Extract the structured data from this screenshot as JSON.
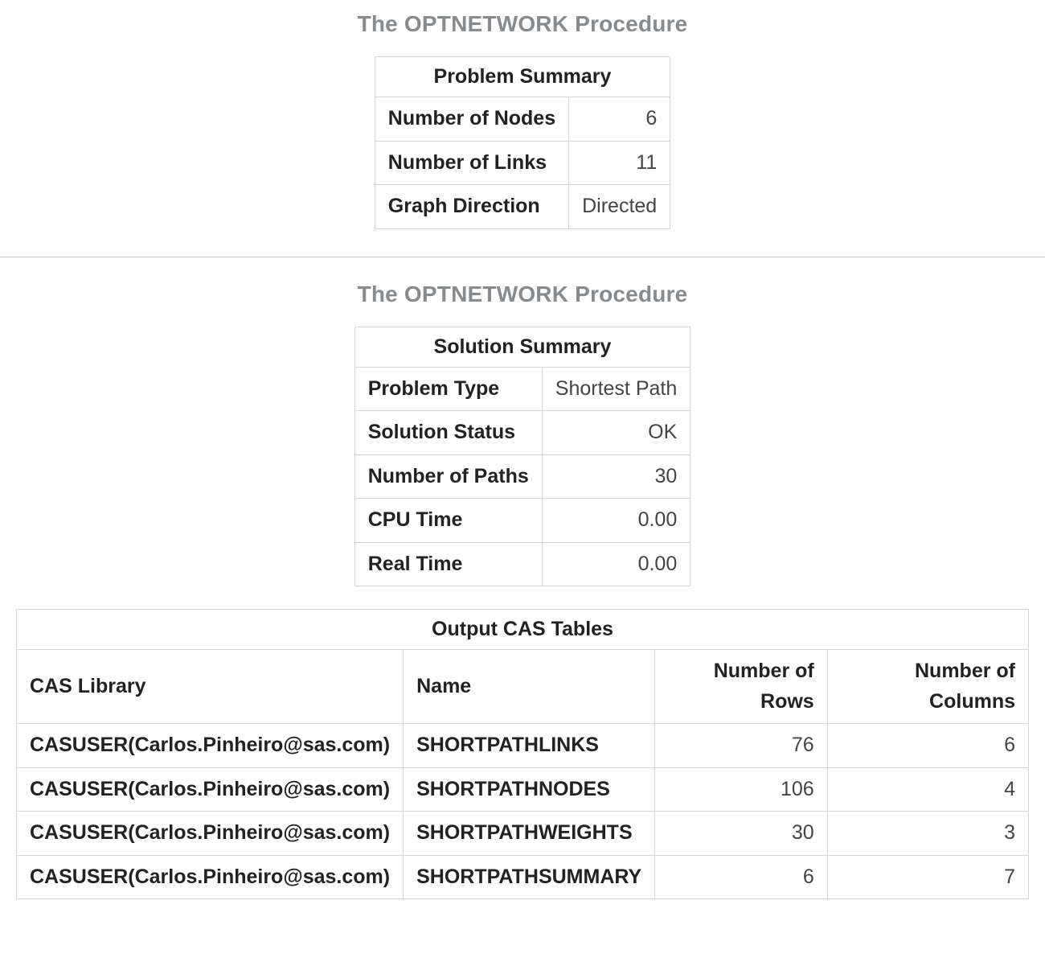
{
  "section1": {
    "title": "The OPTNETWORK Procedure",
    "problem_summary": {
      "caption": "Problem Summary",
      "rows": [
        {
          "label": "Number of Nodes",
          "value": "6"
        },
        {
          "label": "Number of Links",
          "value": "11"
        },
        {
          "label": "Graph Direction",
          "value": "Directed"
        }
      ]
    }
  },
  "section2": {
    "title": "The OPTNETWORK Procedure",
    "solution_summary": {
      "caption": "Solution Summary",
      "rows": [
        {
          "label": "Problem Type",
          "value": "Shortest Path"
        },
        {
          "label": "Solution Status",
          "value": "OK"
        },
        {
          "label": "Number of Paths",
          "value": "30"
        },
        {
          "label": "CPU Time",
          "value": "0.00"
        },
        {
          "label": "Real Time",
          "value": "0.00"
        }
      ]
    },
    "output_cas": {
      "caption": "Output CAS Tables",
      "headers": {
        "lib": "CAS Library",
        "name": "Name",
        "rows": "Number of Rows",
        "cols": "Number of Columns"
      },
      "rows": [
        {
          "lib": "CASUSER(Carlos.Pinheiro@sas.com)",
          "name": "SHORTPATHLINKS",
          "rows": "76",
          "cols": "6"
        },
        {
          "lib": "CASUSER(Carlos.Pinheiro@sas.com)",
          "name": "SHORTPATHNODES",
          "rows": "106",
          "cols": "4"
        },
        {
          "lib": "CASUSER(Carlos.Pinheiro@sas.com)",
          "name": "SHORTPATHWEIGHTS",
          "rows": "30",
          "cols": "3"
        },
        {
          "lib": "CASUSER(Carlos.Pinheiro@sas.com)",
          "name": "SHORTPATHSUMMARY",
          "rows": "6",
          "cols": "7"
        }
      ]
    }
  }
}
